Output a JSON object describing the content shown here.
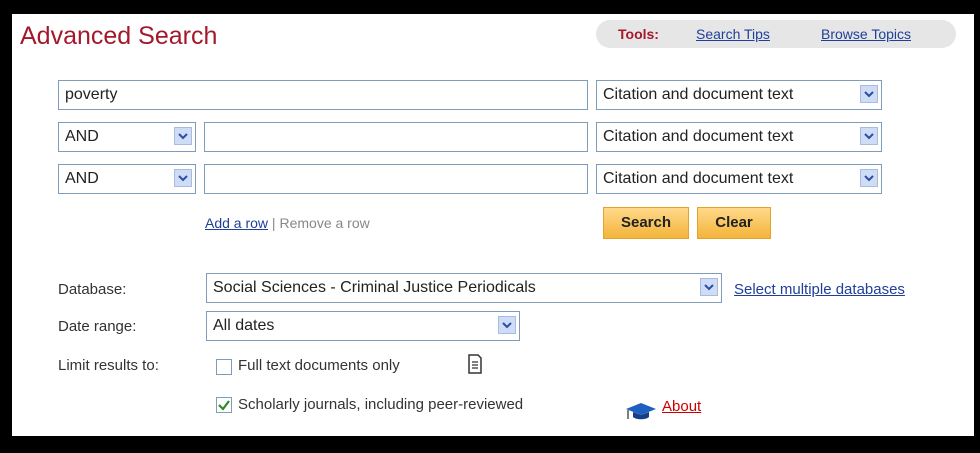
{
  "header": {
    "title": "Advanced Search"
  },
  "tools": {
    "label": "Tools:",
    "search_tips": "Search Tips",
    "browse_topics": "Browse Topics"
  },
  "rows": [
    {
      "term": "poverty",
      "field": "Citation and document text"
    },
    {
      "operator": "AND",
      "term": "",
      "field": "Citation and document text"
    },
    {
      "operator": "AND",
      "term": "",
      "field": "Citation and document text"
    }
  ],
  "row_links": {
    "add": "Add a row",
    "separator": " | ",
    "remove": "Remove a row"
  },
  "buttons": {
    "search": "Search",
    "clear": "Clear"
  },
  "database": {
    "label": "Database:",
    "value": "Social Sciences - Criminal Justice Periodicals",
    "link": "Select multiple databases"
  },
  "date_range": {
    "label": "Date range:",
    "value": "All dates"
  },
  "limit": {
    "label": "Limit results to:",
    "full_text": {
      "text": "Full text documents only",
      "checked": false
    },
    "scholarly": {
      "text": "Scholarly journals, including peer-reviewed",
      "checked": true
    },
    "about": "About"
  },
  "icons": {
    "dropdown": "chevron-down-icon",
    "document": "document-icon",
    "scholar": "graduation-cap-icon",
    "check": "check-icon"
  }
}
